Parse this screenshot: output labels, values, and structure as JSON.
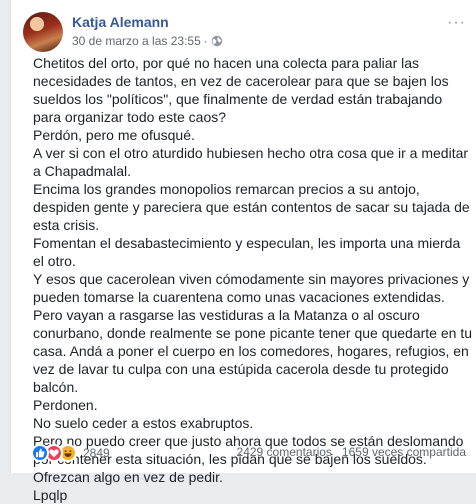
{
  "post": {
    "author": "Katja Alemann",
    "timestamp": "30 de marzo a las 23:55",
    "separator": "·",
    "privacy_icon": "globe-icon",
    "more_icon": "more-options-icon",
    "more_label": "···",
    "paragraphs": [
      "Chetitos del orto, por qué no hacen una colecta para paliar las necesidades de tantos, en vez de cacerolear para que se bajen los sueldos los \"políticos\", que finalmente de verdad están trabajando para organizar todo este caos?",
      "Perdón, pero me ofusqué.",
      "A ver si con el otro aturdido hubiesen hecho otra cosa que ir a meditar a Chapadmalal.",
      "Encima los grandes monopolios remarcan precios a su antojo, despiden gente y pareciera que están contentos de sacar su tajada de esta crisis.",
      "Fomentan el desabastecimiento y especulan, les importa una mierda el otro.",
      "Y esos que cacerolean viven cómodamente sin mayores privaciones y pueden tomarse la cuarentena como unas vacaciones extendidas.",
      "Pero vayan a rasgarse las vestiduras a la Matanza o al oscuro conurbano, donde realmente se pone picante tener que quedarte en tu casa. Andá a poner el cuerpo en los comedores, hogares, refugios, en vez de lavar tu culpa con una estúpida cacerola desde tu protegido balcón.",
      "Perdonen.",
      "No suelo ceder a estos exabruptos.",
      "Pero no puedo creer que justo ahora que todos se están deslomando por contener esta situación, les pidan que se bajen los sueldos.",
      "Ofrezcan algo en vez de pedir.",
      "Lpqlp"
    ]
  },
  "footer": {
    "reaction_icons": [
      "like-icon",
      "love-icon",
      "haha-icon"
    ],
    "reaction_count": "2849",
    "comments": "2429 comentarios",
    "shares": "1659 veces compartida"
  },
  "colors": {
    "author": "#365899",
    "meta": "#616770",
    "text": "#1d2129",
    "like": "#1877f2",
    "love": "#f33e58",
    "haha": "#f7b125"
  }
}
